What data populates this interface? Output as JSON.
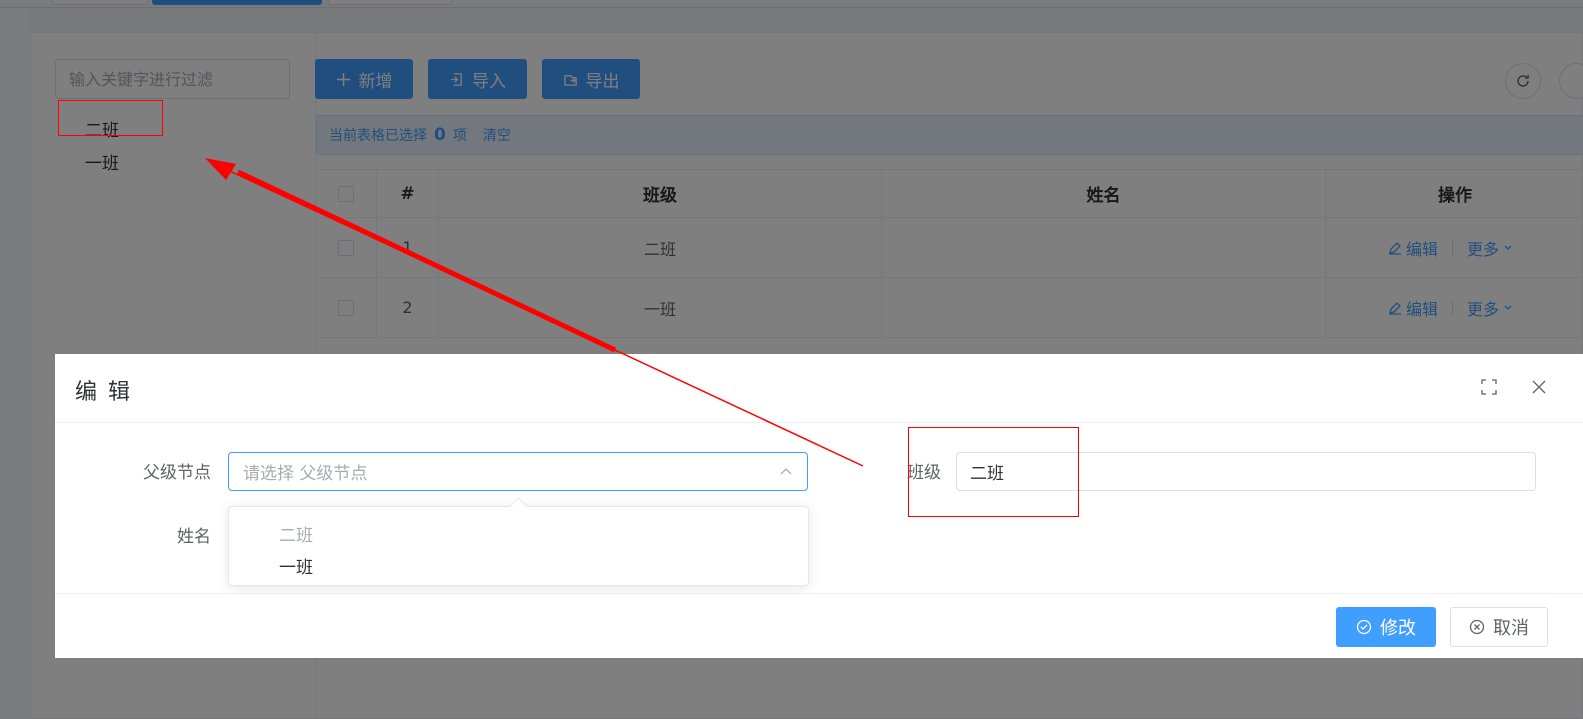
{
  "tree": {
    "filter_placeholder": "输入关键字进行过滤",
    "nodes": [
      "二班",
      "一班"
    ]
  },
  "toolbar": {
    "add_label": "新增",
    "import_label": "导入",
    "export_label": "导出"
  },
  "selection": {
    "prefix": "当前表格已选择",
    "count": "0",
    "suffix": "项",
    "clear_label": "清空"
  },
  "table": {
    "headers": {
      "index": "#",
      "class": "班级",
      "name": "姓名",
      "actions": "操作"
    },
    "rows": [
      {
        "index": "1",
        "class": "二班",
        "name": "",
        "edit": "编辑",
        "more": "更多"
      },
      {
        "index": "2",
        "class": "一班",
        "name": "",
        "edit": "编辑",
        "more": "更多"
      }
    ]
  },
  "dialog": {
    "title": "编 辑",
    "parent_label": "父级节点",
    "parent_placeholder": "请选择 父级节点",
    "name_label": "姓名",
    "class_label": "班级",
    "class_value": "二班",
    "dropdown_options": [
      {
        "label": "二班",
        "disabled": true
      },
      {
        "label": "一班",
        "disabled": false
      }
    ],
    "confirm_label": "修改",
    "cancel_label": "取消"
  },
  "colors": {
    "primary": "#409eff",
    "annotation": "#ff0000"
  }
}
